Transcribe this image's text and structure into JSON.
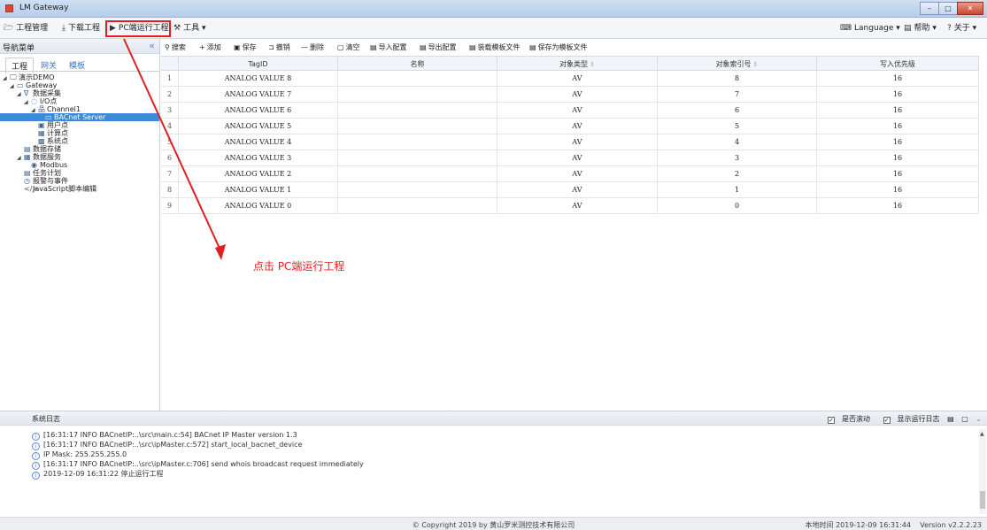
{
  "window": {
    "title": "LM Gateway"
  },
  "menu": {
    "project_mgmt": "工程管理",
    "download_project": "下载工程",
    "pc_run_project": "PC端运行工程",
    "tools": "工具",
    "language": "Language",
    "help": "帮助",
    "about": "关于"
  },
  "nav": {
    "title": "导航菜单",
    "tabs": [
      "工程",
      "网关",
      "模板"
    ],
    "tree": [
      {
        "label": "演示DEMO",
        "icon": "monitor-icon"
      },
      {
        "label": "Gateway",
        "icon": "gateway-icon"
      },
      {
        "label": "数据采集",
        "icon": "filter-icon"
      },
      {
        "label": "I/O点",
        "icon": "io-icon"
      },
      {
        "label": "Channel1",
        "icon": "channel-icon"
      },
      {
        "label": "BACnet Server",
        "icon": "server-icon"
      },
      {
        "label": "用户点",
        "icon": "user-point-icon"
      },
      {
        "label": "计算点",
        "icon": "calc-point-icon"
      },
      {
        "label": "系统点",
        "icon": "system-point-icon"
      },
      {
        "label": "数据存储",
        "icon": "storage-icon"
      },
      {
        "label": "数据服务",
        "icon": "service-icon"
      },
      {
        "label": "Modbus",
        "icon": "modbus-icon"
      },
      {
        "label": "任务计划",
        "icon": "task-icon"
      },
      {
        "label": "报警与事件",
        "icon": "alarm-icon"
      },
      {
        "label": "JavaScript脚本编辑",
        "icon": "code-icon"
      }
    ]
  },
  "toolbar": {
    "search": "搜索",
    "add": "添加",
    "save": "保存",
    "undo": "撤销",
    "delete": "删除",
    "clear": "清空",
    "import": "导入配置",
    "export": "导出配置",
    "load_template": "装载模板文件",
    "save_template": "保存为模板文件"
  },
  "table": {
    "headers": [
      "TagID",
      "名称",
      "对象类型",
      "对象索引号",
      "写入优先级"
    ],
    "rows": [
      [
        "1",
        "ANALOG VALUE 8",
        "",
        "AV",
        "8",
        "16"
      ],
      [
        "2",
        "ANALOG VALUE 7",
        "",
        "AV",
        "7",
        "16"
      ],
      [
        "3",
        "ANALOG VALUE 6",
        "",
        "AV",
        "6",
        "16"
      ],
      [
        "4",
        "ANALOG VALUE 5",
        "",
        "AV",
        "5",
        "16"
      ],
      [
        "5",
        "ANALOG VALUE 4",
        "",
        "AV",
        "4",
        "16"
      ],
      [
        "6",
        "ANALOG VALUE 3",
        "",
        "AV",
        "3",
        "16"
      ],
      [
        "7",
        "ANALOG VALUE 2",
        "",
        "AV",
        "2",
        "16"
      ],
      [
        "8",
        "ANALOG VALUE 1",
        "",
        "AV",
        "1",
        "16"
      ],
      [
        "9",
        "ANALOG VALUE 0",
        "",
        "AV",
        "0",
        "16"
      ]
    ]
  },
  "annotation": {
    "text": "点击 PC端运行工程",
    "color": "#e02020"
  },
  "log": {
    "title": "系统日志",
    "autoscroll": "是否滚动",
    "show_run_log": "显示运行日志",
    "lines": [
      "[16:31:17 INFO BACnetIP:..\\src\\main.c:54] BACnet IP Master version 1.3",
      "[16:31:17 INFO BACnetIP:..\\src\\ipMaster.c:572] start_local_bacnet_device",
      "IP Mask: 255.255.255.0",
      "[16:31:17 INFO BACnetIP:..\\src\\ipMaster.c:706] send whois broadcast request immediately",
      "2019-12-09 16:31:22 停止运行工程"
    ]
  },
  "footer": {
    "copyright": "© Copyright 2019 by 黄山罗米测控技术有限公司",
    "local_time": "本地时间 2019-12-09 16:31:44",
    "version": "Version v2.2.2.23"
  },
  "colors": {
    "accent": "#3d8ad9",
    "highlight": "#e02020"
  }
}
